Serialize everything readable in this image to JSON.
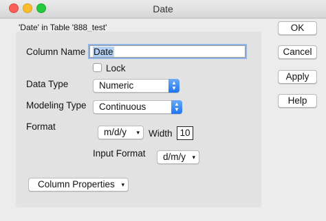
{
  "window": {
    "title": "Date"
  },
  "subtitle": "'Date' in Table '888_test'",
  "form": {
    "column_name_label": "Column Name",
    "column_name_value": "Date",
    "lock_label": "Lock",
    "lock_checked": false,
    "data_type_label": "Data Type",
    "data_type_value": "Numeric",
    "modeling_type_label": "Modeling Type",
    "modeling_type_value": "Continuous",
    "format_label": "Format",
    "format_value": "m/d/y",
    "width_label": "Width",
    "width_value": "10",
    "input_format_label": "Input Format",
    "input_format_value": "d/m/y",
    "column_properties_label": "Column Properties"
  },
  "buttons": {
    "ok": "OK",
    "cancel": "Cancel",
    "apply": "Apply",
    "help": "Help"
  },
  "icons": {
    "caret": "▾",
    "stepper_up": "▲",
    "stepper_down": "▼"
  },
  "colors": {
    "accent": "#1f74f0",
    "close": "#fc5f57",
    "minimize": "#fdbc2e",
    "maximize": "#28c840",
    "selection": "#b3d1f6"
  }
}
